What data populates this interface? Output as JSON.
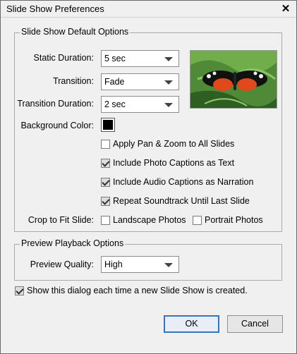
{
  "window": {
    "title": "Slide Show Preferences"
  },
  "default_options": {
    "legend": "Slide Show Default Options",
    "static_duration": {
      "label": "Static Duration:",
      "value": "5 sec"
    },
    "transition": {
      "label": "Transition:",
      "value": "Fade"
    },
    "transition_duration": {
      "label": "Transition Duration:",
      "value": "2 sec"
    },
    "background_color": {
      "label": "Background Color:",
      "color": "#000000"
    },
    "checkboxes": [
      {
        "label": "Apply Pan & Zoom to All Slides",
        "checked": false
      },
      {
        "label": "Include Photo Captions as Text",
        "checked": true
      },
      {
        "label": "Include Audio Captions as Narration",
        "checked": true
      },
      {
        "label": "Repeat Soundtrack Until Last Slide",
        "checked": true
      }
    ],
    "crop_to_fit": {
      "label": "Crop to Fit Slide:",
      "landscape": {
        "label": "Landscape Photos",
        "checked": false
      },
      "portrait": {
        "label": "Portrait Photos",
        "checked": false
      }
    }
  },
  "preview_options": {
    "legend": "Preview Playback Options",
    "quality": {
      "label": "Preview Quality:",
      "value": "High"
    }
  },
  "show_dialog": {
    "label": "Show this dialog each time a new Slide Show is created.",
    "checked": true
  },
  "buttons": {
    "ok": "OK",
    "cancel": "Cancel"
  }
}
